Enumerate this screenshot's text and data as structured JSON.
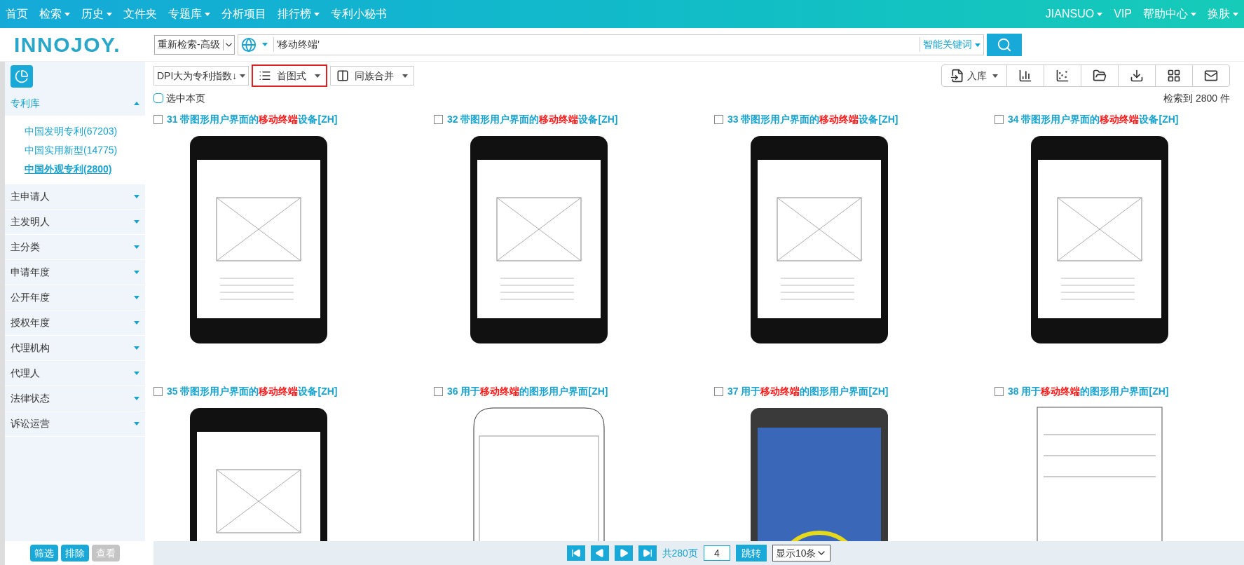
{
  "nav": {
    "left": [
      {
        "label": "首页",
        "dropdown": false
      },
      {
        "label": "检索",
        "dropdown": true
      },
      {
        "label": "历史",
        "dropdown": true
      },
      {
        "label": "文件夹",
        "dropdown": false
      },
      {
        "label": "专题库",
        "dropdown": true
      },
      {
        "label": "分析项目",
        "dropdown": false
      },
      {
        "label": "排行榜",
        "dropdown": true
      },
      {
        "label": "专利小秘书",
        "dropdown": false
      }
    ],
    "right": [
      {
        "label": "JIANSUO",
        "dropdown": true
      },
      {
        "label": "VIP",
        "dropdown": false
      },
      {
        "label": "帮助中心",
        "dropdown": true
      },
      {
        "label": "换肤",
        "dropdown": true
      }
    ]
  },
  "logo": "INNOJOY.",
  "search": {
    "mode": "重新检索-高级",
    "query": "'移动终端'",
    "smart": "智能关键词"
  },
  "toolbar": {
    "sort": "DPI大为专利指数↓",
    "view": "首图式",
    "merge": "同族合并",
    "import": "入库",
    "select_page": "选中本页",
    "select_page_checked": false,
    "count": "检索到 2800 件"
  },
  "sidebar": {
    "sections": [
      {
        "label": "专利库",
        "expanded": true,
        "children": [
          {
            "label": "中国发明专利(67203)",
            "selected": false
          },
          {
            "label": "中国实用新型(14775)",
            "selected": false
          },
          {
            "label": "中国外观专利(2800)",
            "selected": true
          }
        ]
      },
      {
        "label": "主申请人",
        "expanded": false
      },
      {
        "label": "主发明人",
        "expanded": false
      },
      {
        "label": "主分类",
        "expanded": false
      },
      {
        "label": "申请年度",
        "expanded": false
      },
      {
        "label": "公开年度",
        "expanded": false
      },
      {
        "label": "授权年度",
        "expanded": false
      },
      {
        "label": "代理机构",
        "expanded": false
      },
      {
        "label": "代理人",
        "expanded": false
      },
      {
        "label": "法律状态",
        "expanded": false
      },
      {
        "label": "诉讼运营",
        "expanded": false
      }
    ],
    "buttons": [
      {
        "label": "筛选",
        "disabled": false
      },
      {
        "label": "排除",
        "disabled": false
      },
      {
        "label": "查看",
        "disabled": true
      }
    ]
  },
  "results": [
    {
      "number": "31",
      "before": "带图形用户界面的",
      "highlight": "移动终端",
      "after": "设备[ZH]",
      "checked": false,
      "kind": "black-phone"
    },
    {
      "number": "32",
      "before": "带图形用户界面的",
      "highlight": "移动终端",
      "after": "设备[ZH]",
      "checked": false,
      "kind": "black-phone"
    },
    {
      "number": "33",
      "before": "带图形用户界面的",
      "highlight": "移动终端",
      "after": "设备[ZH]",
      "checked": false,
      "kind": "black-phone"
    },
    {
      "number": "34",
      "before": "带图形用户界面的",
      "highlight": "移动终端",
      "after": "设备[ZH]",
      "checked": false,
      "kind": "black-phone"
    },
    {
      "number": "35",
      "before": "带图形用户界面的",
      "highlight": "移动终端",
      "after": "设备[ZH]",
      "checked": false,
      "kind": "black-phone"
    },
    {
      "number": "36",
      "before": "用于",
      "highlight": "移动终端",
      "after": "的图形用户界面[ZH]",
      "checked": false,
      "kind": "outline-phone"
    },
    {
      "number": "37",
      "before": "用于",
      "highlight": "移动终端",
      "after": "的图形用户界面[ZH]",
      "checked": false,
      "kind": "blue-phone"
    },
    {
      "number": "38",
      "before": "用于",
      "highlight": "移动终端",
      "after": "的图形用户界面[ZH]",
      "checked": false,
      "kind": "wireframe"
    }
  ],
  "pager": {
    "total": "共280页",
    "page": "4",
    "go": "跳转",
    "per_page": "显示10条"
  }
}
